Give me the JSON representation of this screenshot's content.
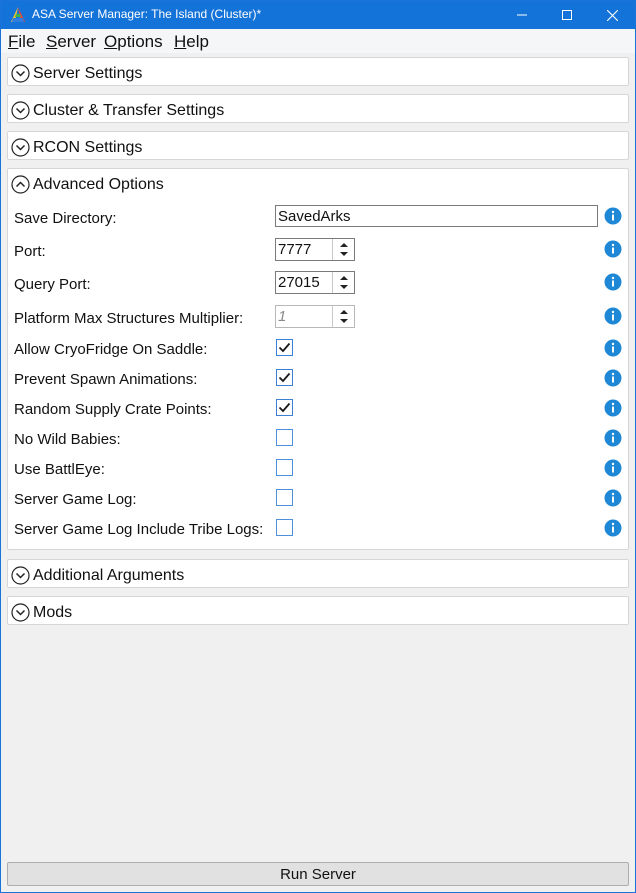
{
  "window": {
    "title": "ASA Server Manager: The Island (Cluster)*",
    "accent_color": "#1473d8",
    "controls": {
      "minimize_icon": "minimize-icon",
      "maximize_icon": "maximize-icon",
      "close_icon": "close-icon"
    }
  },
  "menu": {
    "items": [
      {
        "label": "File"
      },
      {
        "label": "Server"
      },
      {
        "label": "Options"
      },
      {
        "label": "Help"
      }
    ]
  },
  "sections": {
    "server_settings": {
      "title": "Server Settings",
      "expanded": false
    },
    "cluster_transfer": {
      "title": "Cluster & Transfer Settings",
      "expanded": false
    },
    "rcon": {
      "title": "RCON Settings",
      "expanded": false
    },
    "advanced": {
      "title": "Advanced Options",
      "expanded": true,
      "save_directory": {
        "label": "Save Directory:",
        "value": "SavedArks"
      },
      "port": {
        "label": "Port:",
        "value": "7777"
      },
      "query_port": {
        "label": "Query Port:",
        "value": "27015"
      },
      "platform_max": {
        "label": "Platform Max Structures Multiplier:",
        "value": "1",
        "enabled": false
      },
      "checkboxes": [
        {
          "label": "Allow CryoFridge On Saddle:",
          "checked": true
        },
        {
          "label": "Prevent Spawn Animations:",
          "checked": true
        },
        {
          "label": "Random Supply Crate Points:",
          "checked": true
        },
        {
          "label": "No Wild Babies:",
          "checked": false
        },
        {
          "label": "Use BattlEye:",
          "checked": false
        },
        {
          "label": "Server Game Log:",
          "checked": false
        },
        {
          "label": "Server Game Log Include Tribe Logs:",
          "checked": false
        }
      ]
    },
    "additional_arguments": {
      "title": "Additional Arguments",
      "expanded": false
    },
    "mods": {
      "title": "Mods",
      "expanded": false
    }
  },
  "footer": {
    "run_button": "Run Server"
  },
  "colors": {
    "info_icon": "#1e88d6",
    "checkbox_border": "#3b7fd1"
  }
}
